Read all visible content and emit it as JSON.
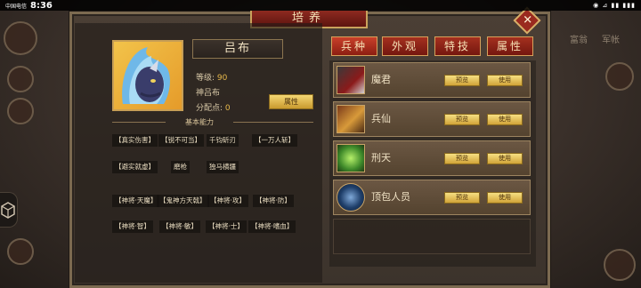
{
  "status_bar": {
    "carrier": "中国电信",
    "time": "8:36"
  },
  "window": {
    "title": "培养",
    "close_symbol": "✕"
  },
  "general": {
    "name": "吕布",
    "level_label": "等级:",
    "level_value": "90",
    "skin_name": "神吕布",
    "points_label": "分配点:",
    "points_value": "0",
    "attr_button": "属性"
  },
  "abilities": {
    "title": "基本能力",
    "rows": [
      [
        "【真实伤害】",
        "【锐不可当】",
        "千钧斫刃",
        "【一万人斩】"
      ],
      [
        "【避实就虚】",
        "磨枪",
        "独马横疆"
      ],
      [
        "【神将·天魔】",
        "【鬼神方天戟】",
        "【神将·攻】",
        "【神将·防】"
      ],
      [
        "【神将·智】",
        "【神将·敏】",
        "【神将·士】",
        "【神将·嗜血】"
      ]
    ]
  },
  "tabs": [
    {
      "label": "兵种",
      "active": true
    },
    {
      "label": "外观",
      "active": false
    },
    {
      "label": "特技",
      "active": false
    },
    {
      "label": "属性",
      "active": false
    }
  ],
  "troops": [
    {
      "name": "魔君",
      "preview": "预览",
      "use": "使用",
      "icon": "demon-lord-avatar"
    },
    {
      "name": "兵仙",
      "preview": "预览",
      "use": "使用",
      "icon": "soldier-immortal-avatar"
    },
    {
      "name": "刑天",
      "preview": "预览",
      "use": "使用",
      "icon": "xingtian-avatar"
    },
    {
      "name": "顶包人员",
      "preview": "预览",
      "use": "使用",
      "icon": "swirl-orb-icon"
    }
  ],
  "background": {
    "right_labels": [
      "富翁",
      "军帐"
    ]
  },
  "colors": {
    "accent_gold": "#e7b94b",
    "tab_red": "#a4301f",
    "button_gold": "#f6df82"
  }
}
